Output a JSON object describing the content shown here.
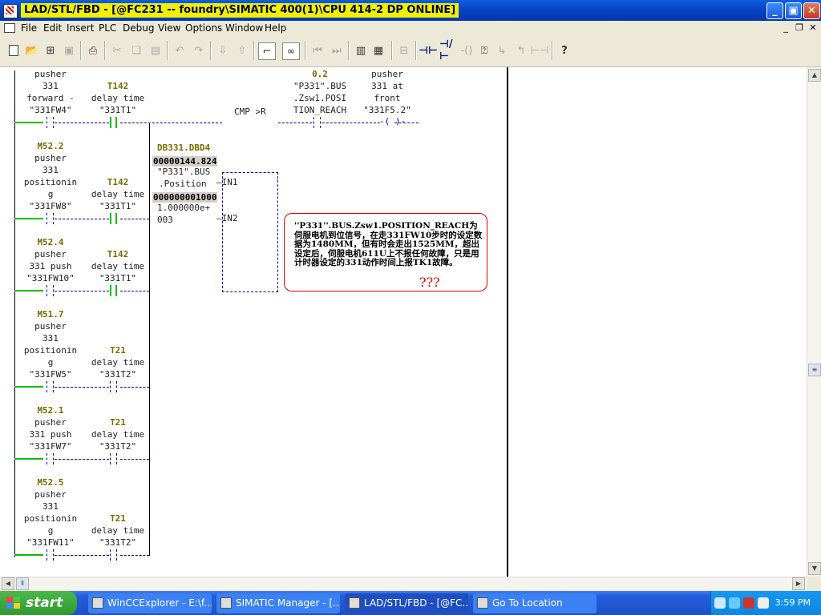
{
  "window": {
    "title": "LAD/STL/FBD  - [@FC231 -- foundry\\SIMATIC 400(1)\\CPU 414-2 DP  ONLINE]",
    "min_glyph": "_",
    "max_glyph": "▣",
    "close_glyph": "✕"
  },
  "menu": {
    "items": [
      "File",
      "Edit",
      "Insert",
      "PLC",
      "Debug",
      "View",
      "Options",
      "Window",
      "Help"
    ],
    "mdi_min": "_",
    "mdi_restore": "❐",
    "mdi_close": "✕"
  },
  "toolbar": {
    "icons": [
      "new-icon",
      "open-icon",
      "accessible-nodes-icon",
      "save-icon",
      "print-icon",
      "cut-icon",
      "copy-icon",
      "paste-icon",
      "undo-icon",
      "redo-icon",
      "download-icon",
      "upload-icon",
      "network-icon",
      "monitor-icon",
      "back-icon",
      "forward-icon",
      "overview-icon",
      "details-icon",
      "insert-box-icon",
      "no-contact-icon",
      "nc-contact-icon",
      "coil-icon",
      "empty-box-icon",
      "branch-open-icon",
      "branch-close-icon",
      "connection-icon",
      "help-icon"
    ]
  },
  "ladder": {
    "rung1": {
      "c1_lines": [
        "pusher",
        "331",
        "forward -",
        "\"331FW4\""
      ],
      "c2_lines": [
        "T142",
        "delay time",
        "\"331T1\""
      ],
      "c3_lines": [
        "0.2",
        "\"P331\".BUS",
        ".Zsw1.POSI",
        "TION_REACH"
      ],
      "c4_lines": [
        "pusher",
        "331 at",
        "front",
        "\"331F5.2\""
      ],
      "cmp_label": "CMP >R"
    },
    "cmp": {
      "in1_addr": "DB331.DBD4",
      "in1_value": "00000144.824",
      "in1_sym1": "\"P331\".BUS",
      "in1_sym2": ".Position",
      "in1_pin": "IN1",
      "in2_value": "000000001000",
      "in2_sym1": "1.000000e+",
      "in2_sym2": "003",
      "in2_pin": "IN2"
    },
    "rows": [
      {
        "addr": "M52.2",
        "lines": [
          "pusher",
          "331",
          "positionin",
          "g",
          "\"331FW8\""
        ],
        "t_addr": "T142",
        "t_lines": [
          "delay time",
          "\"331T1\""
        ]
      },
      {
        "addr": "M52.4",
        "lines": [
          "pusher",
          "331 push",
          "\"331FW10\""
        ],
        "t_addr": "T142",
        "t_lines": [
          "delay time",
          "\"331T1\""
        ]
      },
      {
        "addr": "M51.7",
        "lines": [
          "pusher",
          "331",
          "positionin",
          "g",
          "\"331FW5\""
        ],
        "t_addr": "T21",
        "t_lines": [
          "delay time",
          "\"331T2\""
        ]
      },
      {
        "addr": "M52.1",
        "lines": [
          "pusher",
          "331 push",
          "\"331FW7\""
        ],
        "t_addr": "T21",
        "t_lines": [
          "delay time",
          "\"331T2\""
        ]
      },
      {
        "addr": "M52.5",
        "lines": [
          "pusher",
          "331",
          "positionin",
          "g",
          "\"331FW11\""
        ],
        "t_addr": "T21",
        "t_lines": [
          "delay time",
          "\"331T2\""
        ]
      }
    ]
  },
  "note": {
    "text": "''P331''.BUS.Zsw1.POSITION_REACH为伺服电机到位信号，在走331FW10步时的设定数据为1480MM，但有时会走出1525MM，超出设定后，伺服电机611U上不报任何故障，只是用计时器设定的331动作时间上报TK1故障。",
    "marks": "???"
  },
  "taskbar": {
    "start": "start",
    "tasks": [
      "WinCCExplorer - E:\\f...",
      "SIMATIC Manager - [...",
      "LAD/STL/FBD  - [@FC...",
      "Go To Location"
    ],
    "time": "3:59 PM"
  }
}
